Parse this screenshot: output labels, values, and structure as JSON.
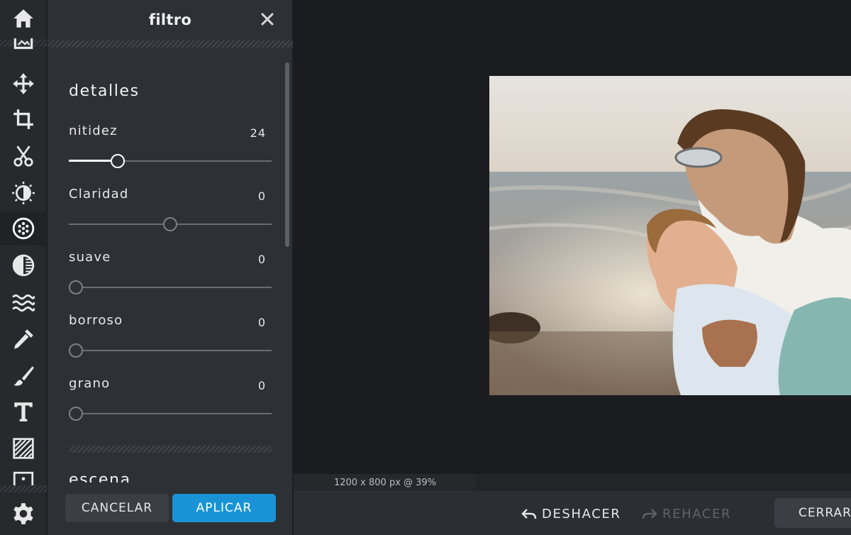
{
  "toolbar": {
    "tools": [
      {
        "name": "home-icon"
      },
      {
        "name": "frame-icon"
      },
      {
        "name": "move-icon"
      },
      {
        "name": "crop-icon"
      },
      {
        "name": "scissors-icon"
      },
      {
        "name": "adjust-icon"
      },
      {
        "name": "filter-icon",
        "active": true
      },
      {
        "name": "effect-icon"
      },
      {
        "name": "liquify-icon"
      },
      {
        "name": "retouch-icon"
      },
      {
        "name": "draw-icon"
      },
      {
        "name": "text-icon"
      },
      {
        "name": "texture-icon"
      },
      {
        "name": "sticker-icon"
      },
      {
        "name": "settings-icon"
      }
    ]
  },
  "panel": {
    "title": "filtro",
    "sections": [
      {
        "title": "detalles",
        "sliders": [
          {
            "label": "nitidez",
            "value": "24",
            "level": 0.24
          },
          {
            "label": "Claridad",
            "value": "0",
            "level": 0.5
          },
          {
            "label": "suave",
            "value": "0",
            "level": 0.0
          },
          {
            "label": "borroso",
            "value": "0",
            "level": 0.0
          },
          {
            "label": "grano",
            "value": "0",
            "level": 0.0
          }
        ]
      },
      {
        "title": "escena"
      }
    ],
    "cancel_label": "CANCELAR",
    "apply_label": "APLICAR"
  },
  "canvas": {
    "size_readout": "1200 x 800 px @ 39%"
  },
  "bottombar": {
    "undo_label": "DESHACER",
    "redo_label": "REHACER",
    "close_label": "CERRAR"
  },
  "colors": {
    "accent": "#1a93d6",
    "panel_bg": "#2d3035",
    "canvas_bg": "#1b1c1f"
  }
}
